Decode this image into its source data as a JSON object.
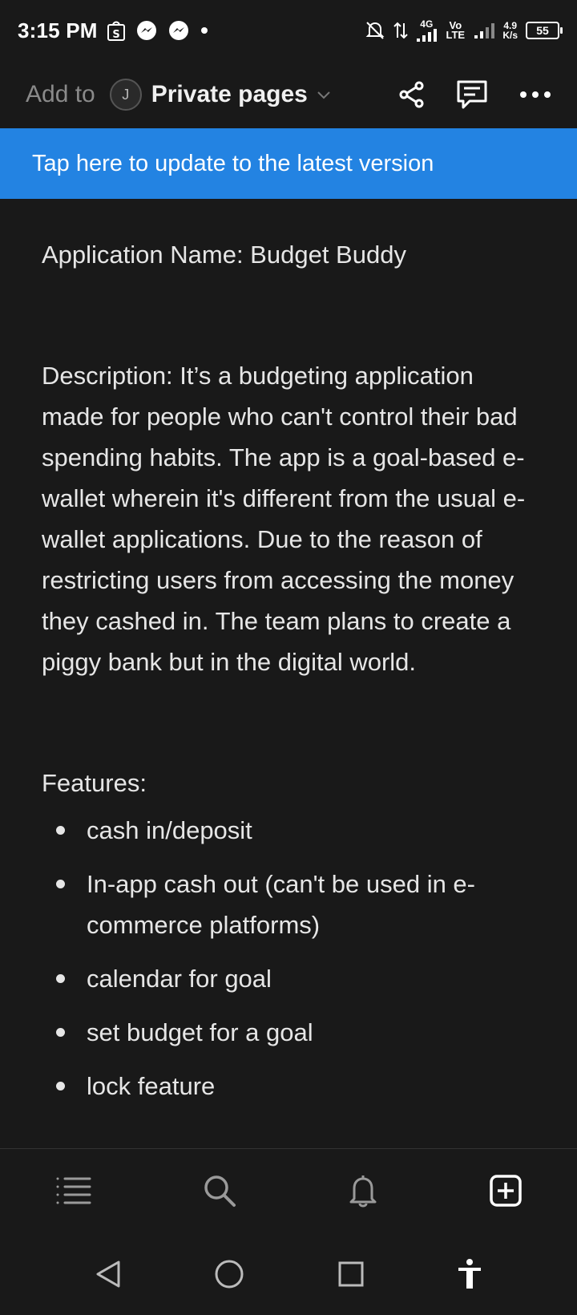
{
  "status_bar": {
    "time": "3:15 PM",
    "network_4g": "4G",
    "volte": "Vo LTE",
    "speed_value": "4.9",
    "speed_unit": "K/s",
    "battery": "55",
    "icons": [
      "shopee-icon",
      "messenger-icon",
      "messenger-icon",
      "dot-icon",
      "bell-off-icon",
      "data-arrows-icon",
      "signal-icon",
      "signal-icon"
    ]
  },
  "top_bar": {
    "add_to": "Add to",
    "avatar_initial": "J",
    "page_selector": "Private pages",
    "actions": [
      "share-icon",
      "comment-icon",
      "more-icon"
    ]
  },
  "banner": {
    "text": "Tap here to update to the latest version"
  },
  "document": {
    "application_name": "Application Name: Budget Buddy",
    "description": "Description: It’s a budgeting application made for people who can't control their bad spending habits. The app is a goal-based e-wallet wherein it's different from the usual e-wallet applications. Due to the reason of restricting users from accessing the money they cashed in. The team plans to create a piggy bank but in the digital world.",
    "features_heading": "Features:",
    "features": [
      "cash in/deposit",
      "In-app cash out (can't be used in e-commerce platforms)",
      "calendar for goal",
      "set budget for a goal",
      "lock feature"
    ]
  },
  "bottom_tabs": [
    "list-icon",
    "search-icon",
    "bell-icon",
    "new-page-icon"
  ],
  "system_nav": [
    "back-icon",
    "home-icon",
    "recents-icon",
    "accessibility-icon"
  ],
  "colors": {
    "background": "#191919",
    "banner": "#2383e2",
    "text": "#e6e6e6"
  }
}
